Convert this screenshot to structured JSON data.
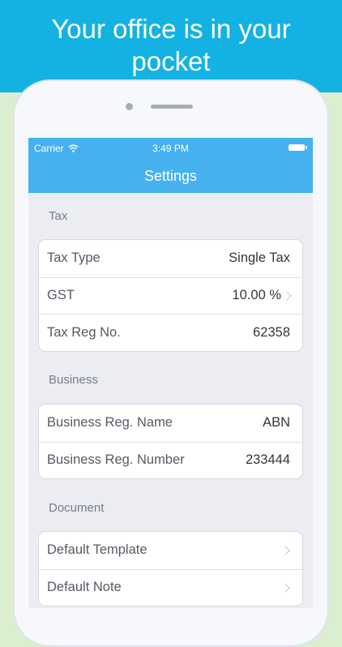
{
  "banner": {
    "text": "Your office is in your pocket"
  },
  "status_bar": {
    "carrier": "Carrier",
    "time": "3:49 PM"
  },
  "nav": {
    "title": "Settings"
  },
  "sections": {
    "tax": {
      "header": "Tax",
      "rows": [
        {
          "label": "Tax Type",
          "value": "Single Tax"
        },
        {
          "label": "GST",
          "value": "10.00 %"
        },
        {
          "label": "Tax Reg No.",
          "value": "62358"
        }
      ]
    },
    "business": {
      "header": "Business",
      "rows": [
        {
          "label": "Business Reg. Name",
          "value": "ABN"
        },
        {
          "label": "Business Reg. Number",
          "value": "233444"
        }
      ]
    },
    "document": {
      "header": "Document",
      "rows": [
        {
          "label": "Default Template"
        },
        {
          "label": "Default Note"
        }
      ]
    }
  },
  "colors": {
    "banner": "#14b2e3",
    "navbar": "#45b2ef",
    "background": "#d9efcf"
  }
}
